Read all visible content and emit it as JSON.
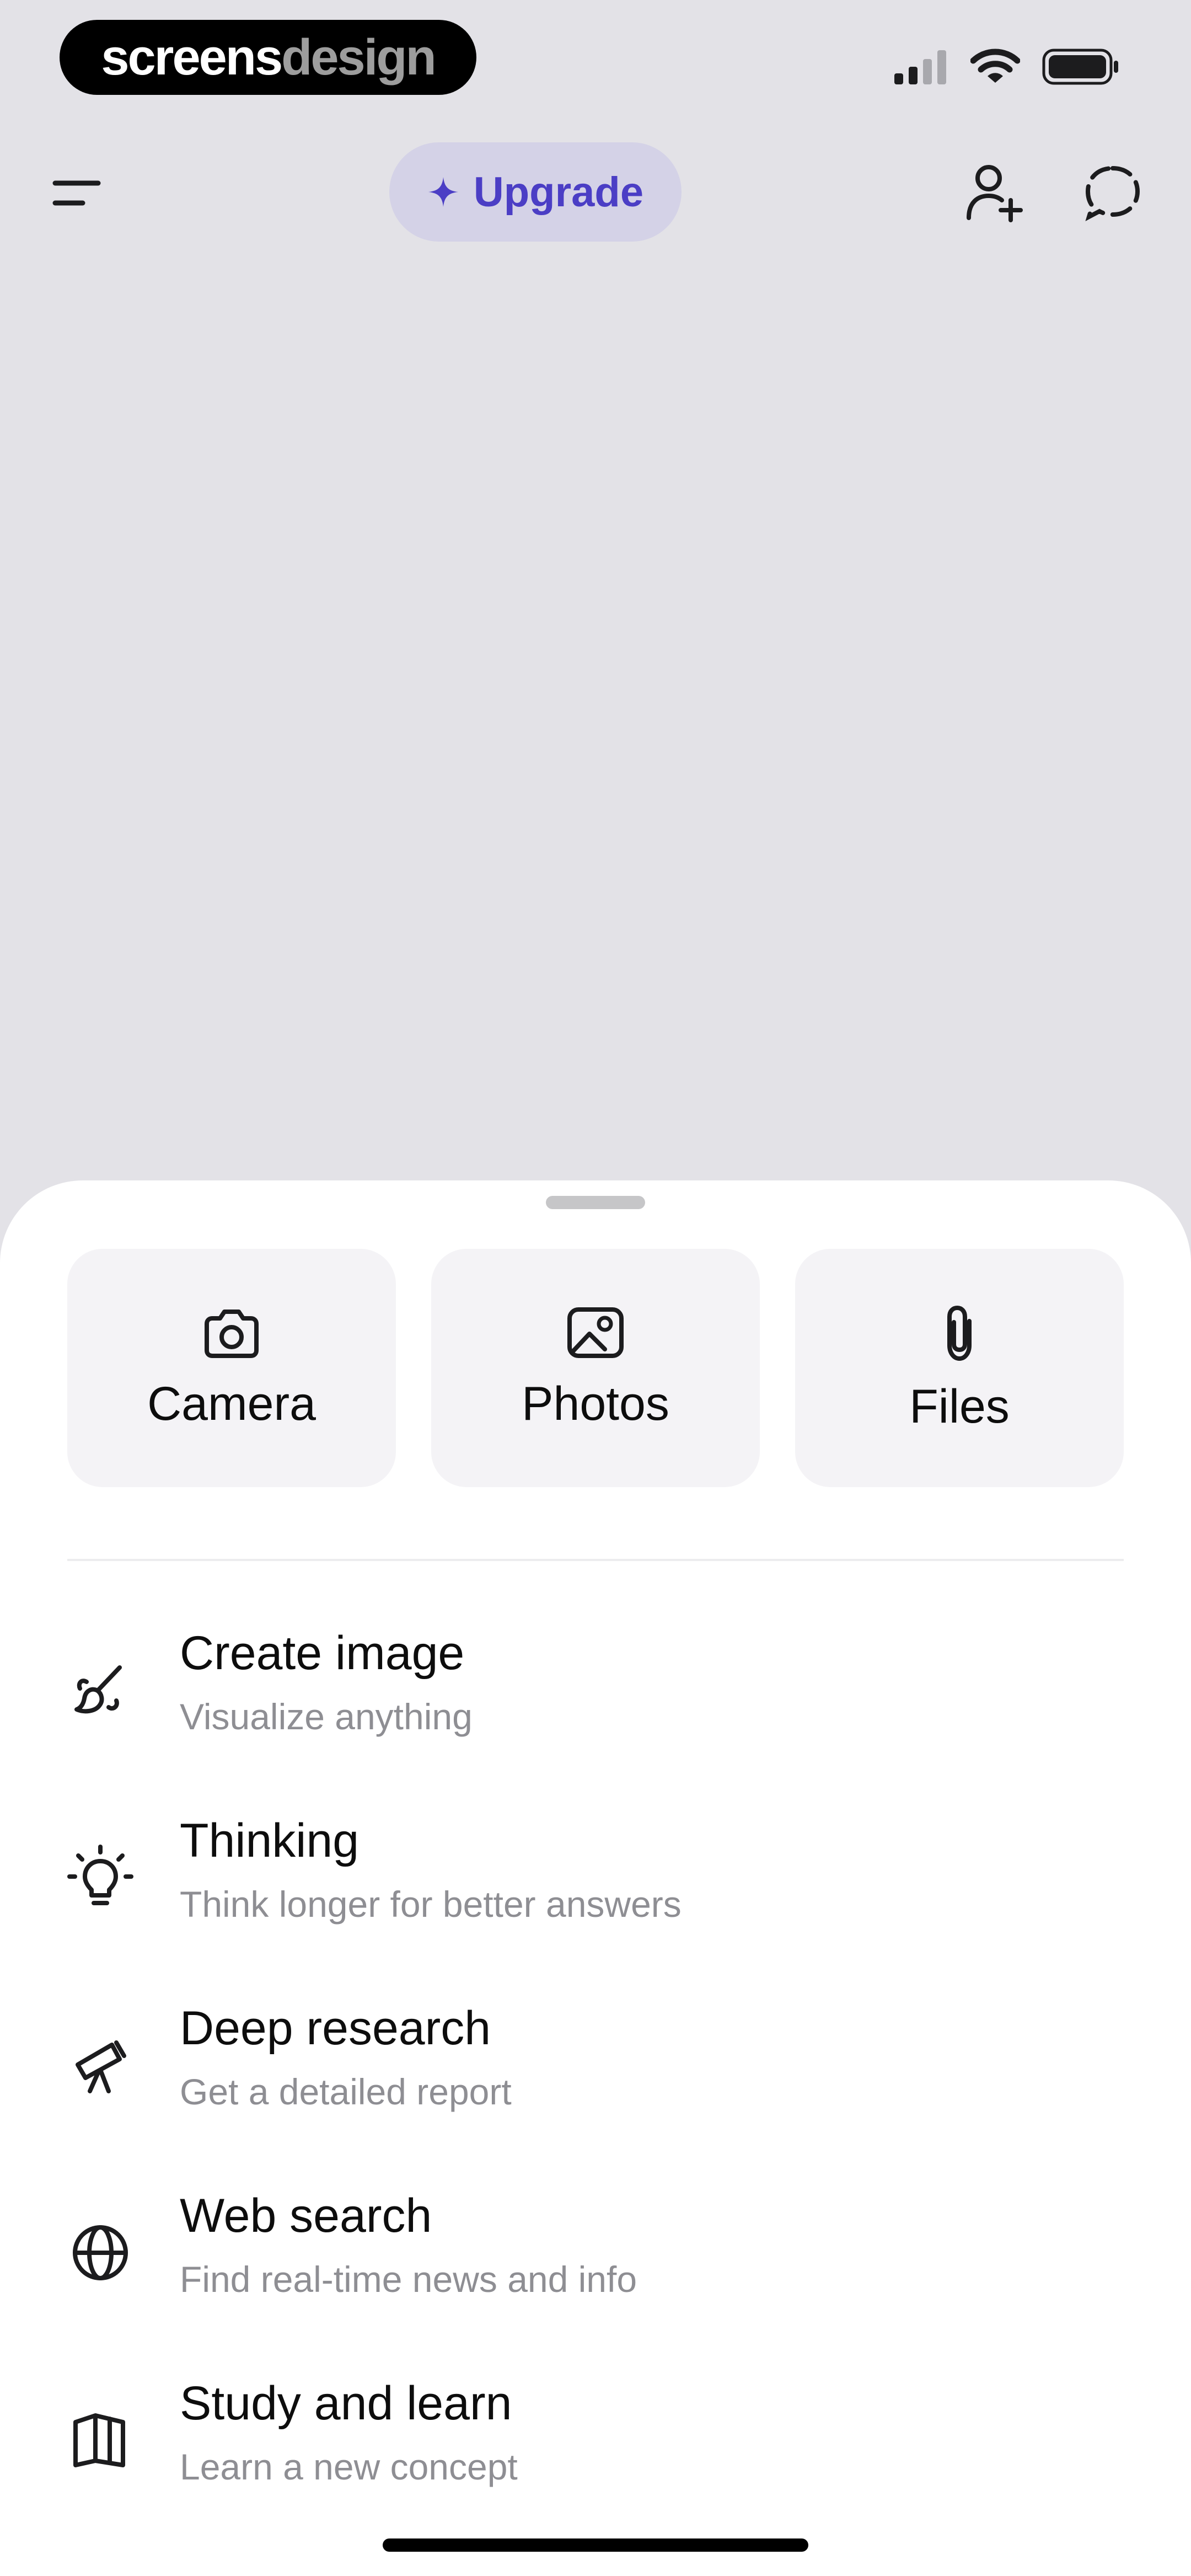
{
  "watermark": {
    "part1": "screens",
    "part2": "design"
  },
  "header": {
    "upgrade_label": "Upgrade",
    "accent_color": "#4b3ec5"
  },
  "attachments": [
    {
      "label": "Camera",
      "icon": "camera-icon"
    },
    {
      "label": "Photos",
      "icon": "photos-icon"
    },
    {
      "label": "Files",
      "icon": "paperclip-icon"
    }
  ],
  "menu": [
    {
      "title": "Create image",
      "subtitle": "Visualize anything",
      "icon": "paintbrush-icon"
    },
    {
      "title": "Thinking",
      "subtitle": "Think longer for better answers",
      "icon": "lightbulb-icon"
    },
    {
      "title": "Deep research",
      "subtitle": "Get a detailed report",
      "icon": "telescope-icon"
    },
    {
      "title": "Web search",
      "subtitle": "Find real-time news and info",
      "icon": "globe-icon"
    },
    {
      "title": "Study and learn",
      "subtitle": "Learn a new concept",
      "icon": "book-icon"
    }
  ]
}
